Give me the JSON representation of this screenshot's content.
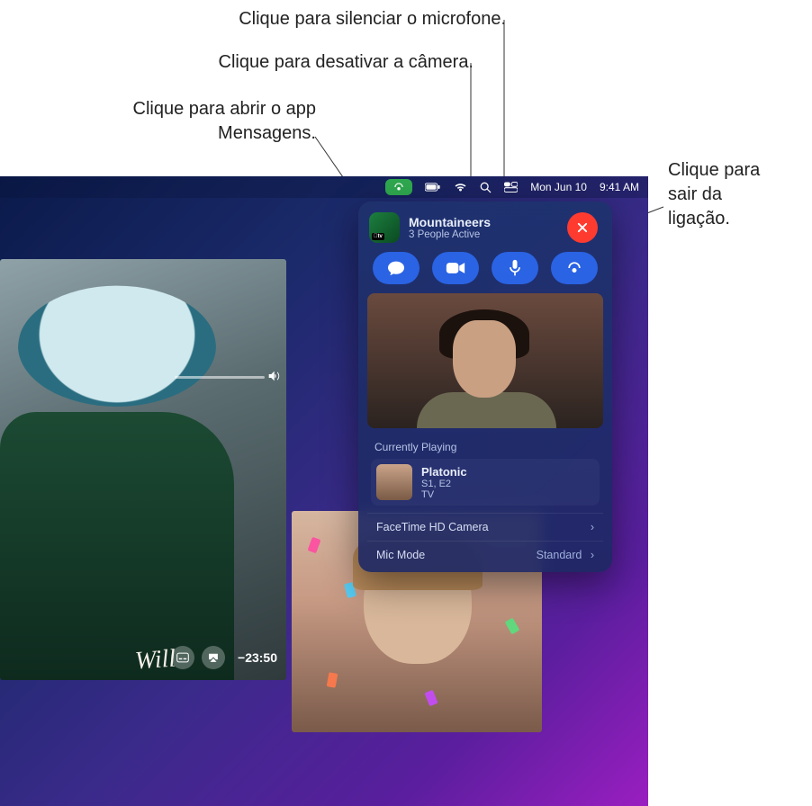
{
  "callouts": {
    "mic": "Clique para silenciar o microfone.",
    "camera": "Clique para desativar a câmera.",
    "messages_line1": "Clique para abrir o app",
    "messages_line2": "Mensagens.",
    "leave_line1": "Clique para",
    "leave_line2": "sair da",
    "leave_line3": "ligação."
  },
  "menubar": {
    "date": "Mon Jun 10",
    "time": "9:41 AM"
  },
  "panel": {
    "title": "Mountaineers",
    "subtitle": "3 People Active",
    "avatar_tag": "tv",
    "currently_playing_label": "Currently Playing",
    "now_playing": {
      "title": "Platonic",
      "line2": "S1, E2",
      "line3": "TV"
    },
    "camera_row": "FaceTime HD Camera",
    "mic_row_label": "Mic Mode",
    "mic_row_value": "Standard"
  },
  "video": {
    "shirt_text": "Will",
    "time_remaining": "−23:50"
  }
}
